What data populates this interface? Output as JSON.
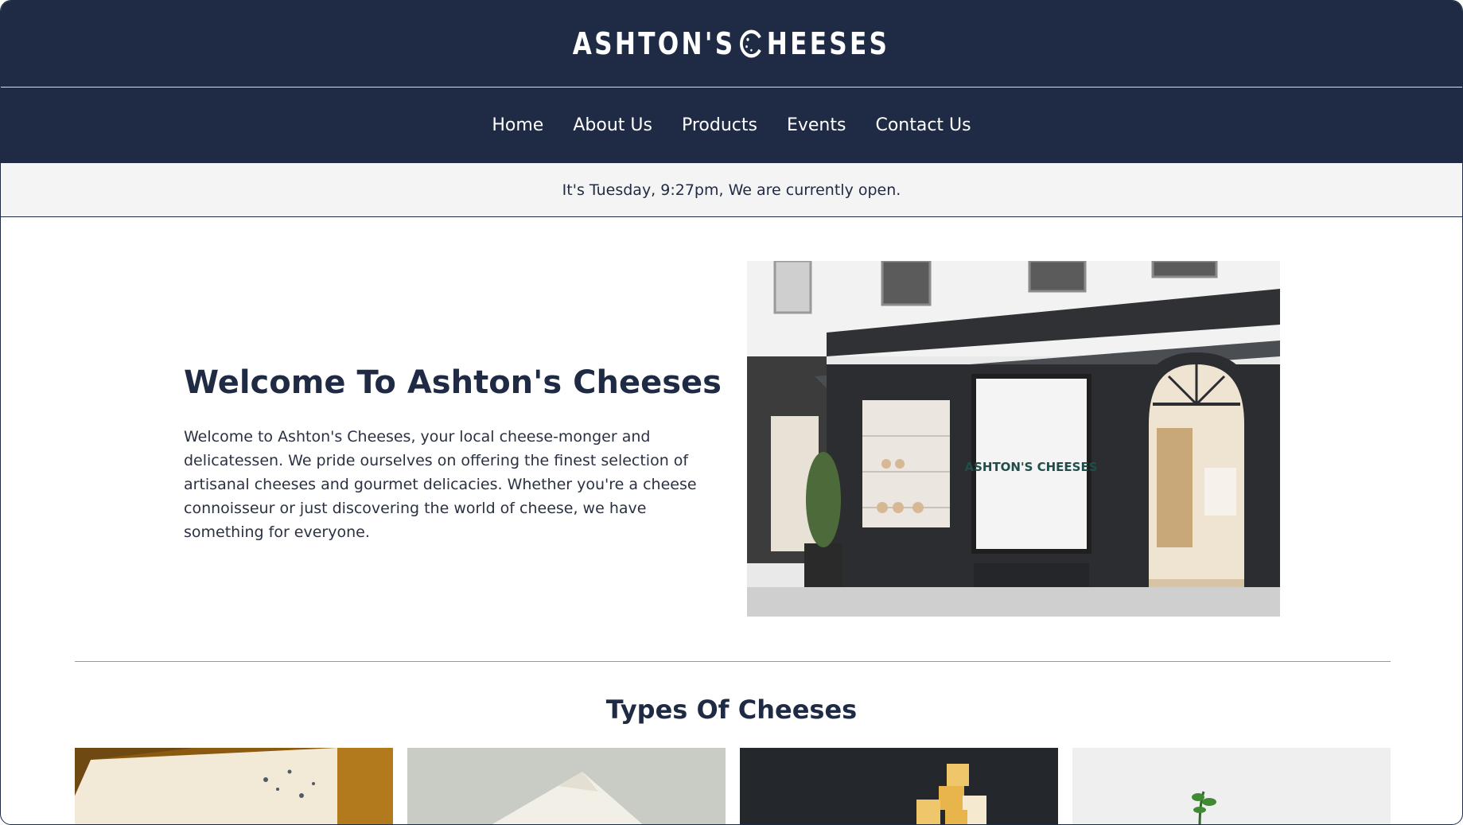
{
  "brand": {
    "name_before_mark": "ASHTON'S",
    "name_after_mark": "HEESES",
    "mark_icon": "cheese-wheel-c-icon"
  },
  "nav": {
    "items": [
      {
        "label": "Home"
      },
      {
        "label": "About Us"
      },
      {
        "label": "Products"
      },
      {
        "label": "Events"
      },
      {
        "label": "Contact Us"
      }
    ]
  },
  "status": {
    "text": "It's Tuesday, 9:27pm, We are currently open."
  },
  "hero": {
    "title": "Welcome To Ashton's Cheeses",
    "body": "Welcome to Ashton's Cheeses, your local cheese-monger and delicatessen. We pride ourselves on offering the finest selection of artisanal cheeses and gourmet delicacies. Whether you're a cheese connoisseur or just discovering the world of cheese, we have something for everyone.",
    "storefront_sign": "ASHTON'S CHEESES"
  },
  "types": {
    "title": "Types Of Cheeses",
    "cards": [
      {
        "image": "blue-cheese-wedge"
      },
      {
        "image": "brie-wedge-on-stone"
      },
      {
        "image": "cheese-cubes-on-slate"
      },
      {
        "image": "herb-garnish-white-background"
      }
    ]
  },
  "colors": {
    "navy": "#1f2a44",
    "status_bg": "#f4f4f4",
    "divider": "#9b9b8a"
  }
}
